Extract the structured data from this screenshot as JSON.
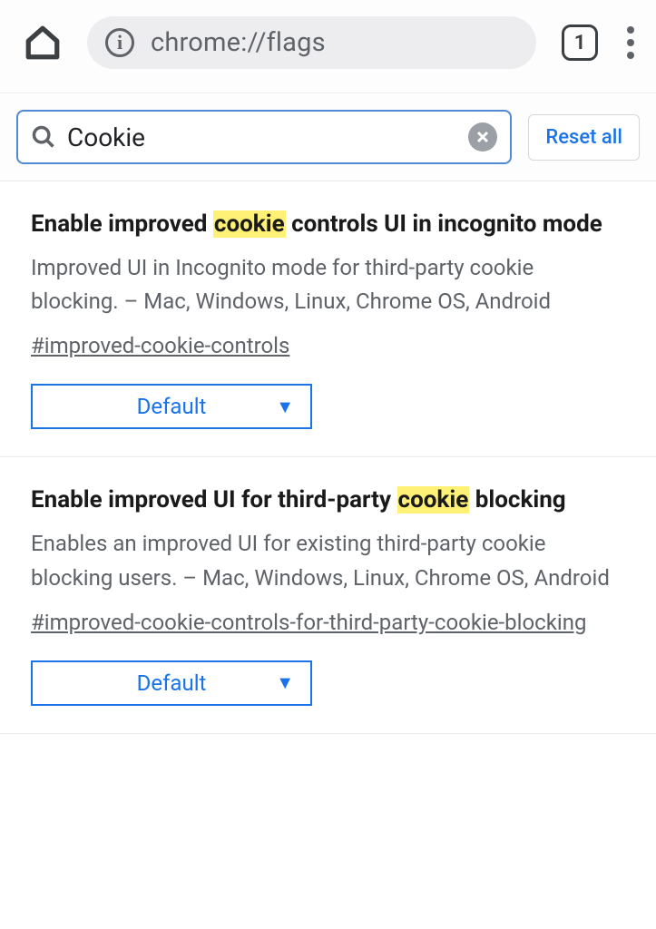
{
  "toolbar": {
    "url": "chrome://flags",
    "tab_count": "1"
  },
  "search": {
    "value": "Cookie",
    "reset_label": "Reset all"
  },
  "flags": [
    {
      "title_pre": "Enable improved ",
      "title_hl": "cookie",
      "title_post": " controls UI in incognito mode",
      "desc": "Improved UI in Incognito mode for third-party cookie blocking. – Mac, Windows, Linux, Chrome OS, Android",
      "slug": "#improved-cookie-controls",
      "select": "Default"
    },
    {
      "title_pre": "Enable improved UI for third-party ",
      "title_hl": "cookie",
      "title_post": " blocking",
      "desc": "Enables an improved UI for existing third-party cookie blocking users. – Mac, Windows, Linux, Chrome OS, Android",
      "slug": "#improved-cookie-controls-for-third-party-cookie-blocking",
      "select": "Default"
    }
  ]
}
